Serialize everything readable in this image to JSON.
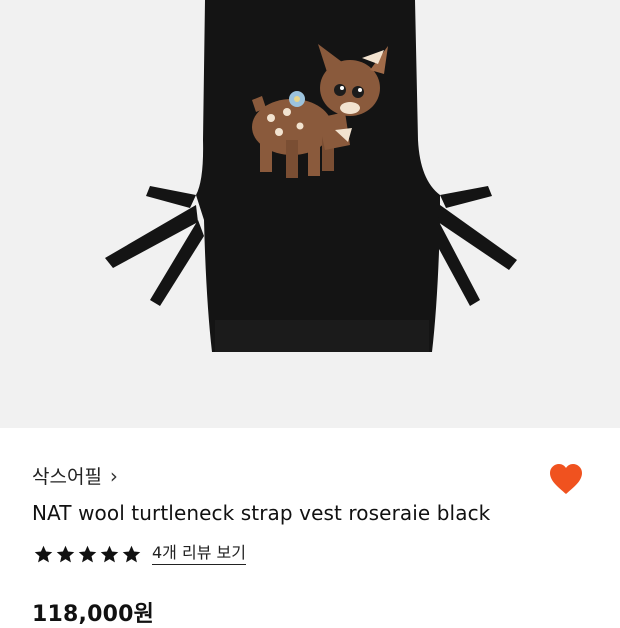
{
  "product": {
    "image_icon": "knit-vest-fawn-image",
    "brand": "삭스어필",
    "brand_chevron": "›",
    "title": "NAT wool turtleneck strap vest roseraie black",
    "rating_stars": 5,
    "review_link": "4개 리뷰 보기",
    "price": "118,000원",
    "liked": true
  },
  "colors": {
    "accent_heart": "#f0521f",
    "star": "#111111",
    "image_background": "#f1f1f1"
  }
}
